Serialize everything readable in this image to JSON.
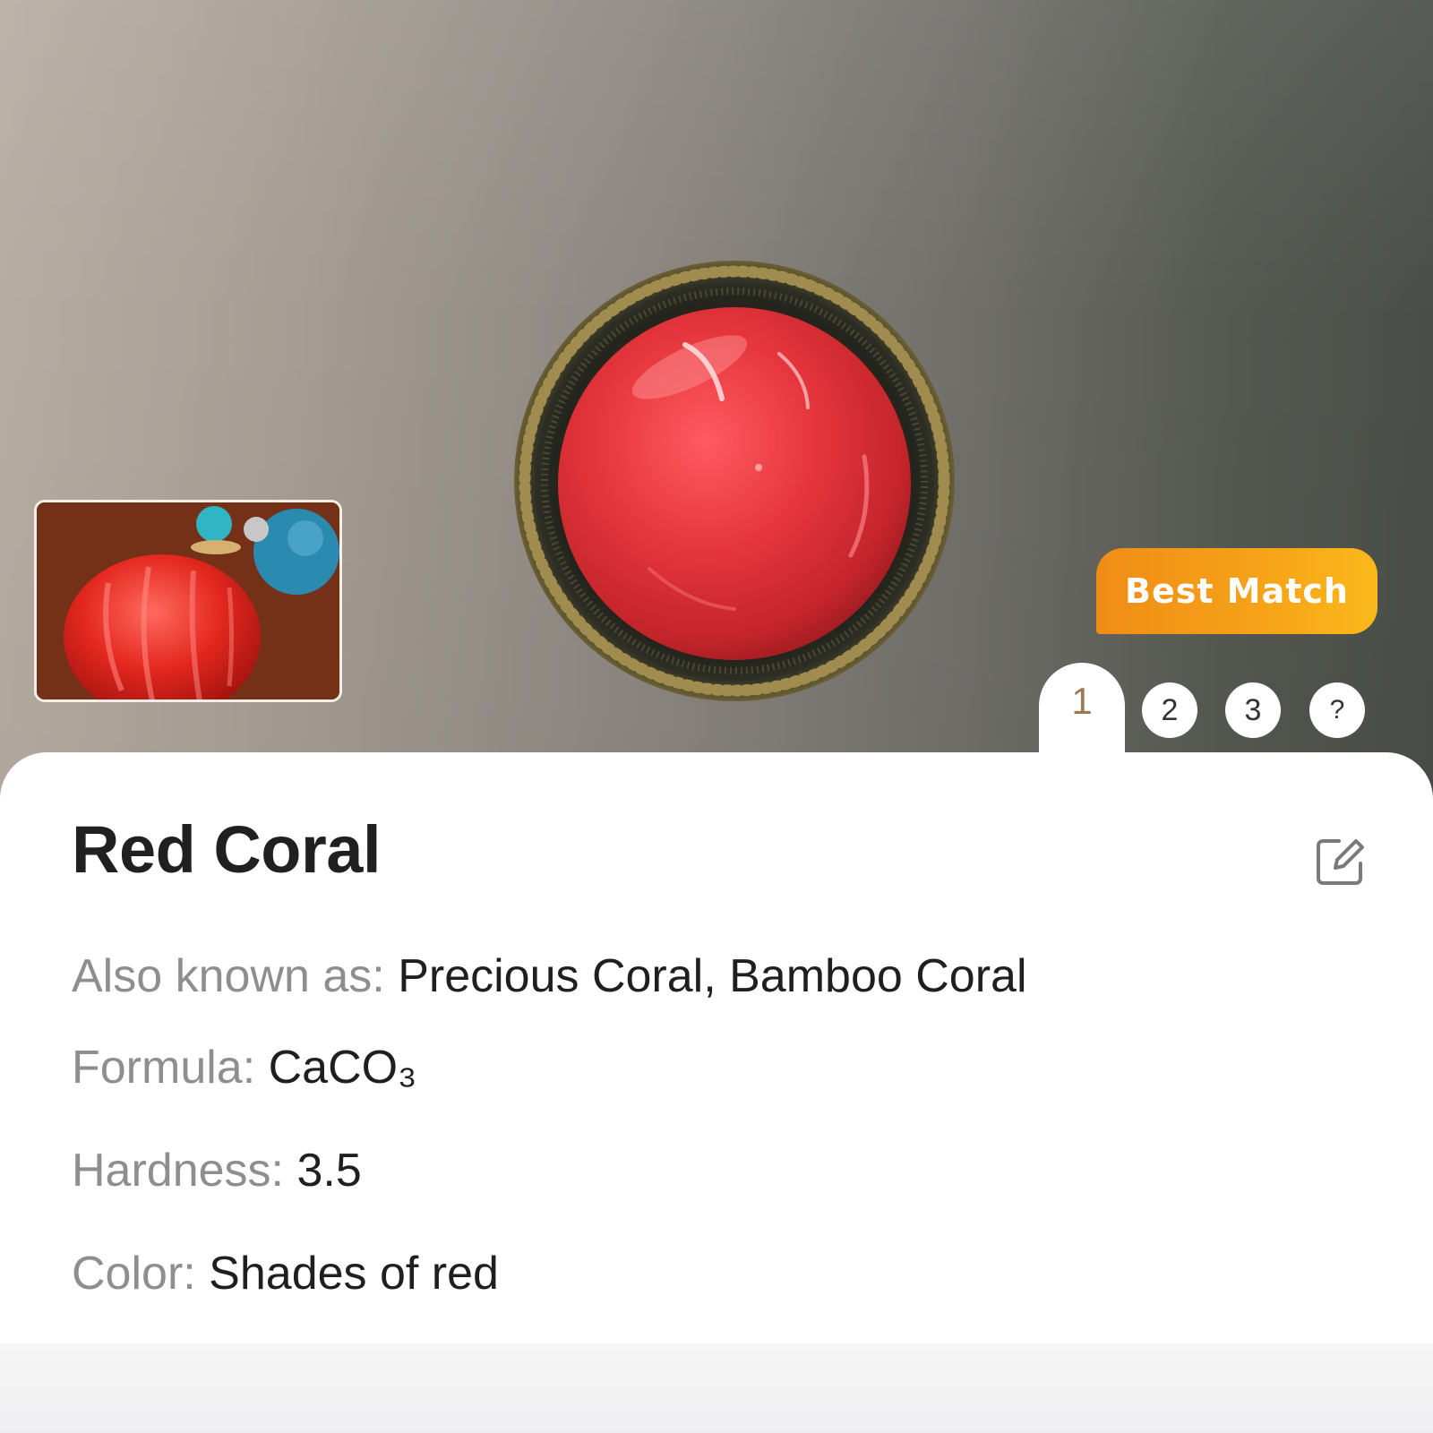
{
  "result": {
    "badge": "Best Match",
    "tabs": [
      "1",
      "2",
      "3",
      "?"
    ],
    "selected_tab": "1"
  },
  "mineral": {
    "name": "Red Coral",
    "also_known_as_label": "Also known as:",
    "also_known_as_value": "Precious Coral, Bamboo Coral",
    "formula_label": "Formula:",
    "formula_value": "CaCO₃",
    "hardness_label": "Hardness:",
    "hardness_value": "3.5",
    "color_label": "Color:",
    "color_value": "Shades of red"
  },
  "icons": {
    "edit": "edit-icon"
  },
  "colors": {
    "accent_orange": "#f39a17",
    "selected_tab_text": "#9a7a55",
    "label_gray": "#8e8e8e",
    "value_dark": "#1f1f1f"
  }
}
